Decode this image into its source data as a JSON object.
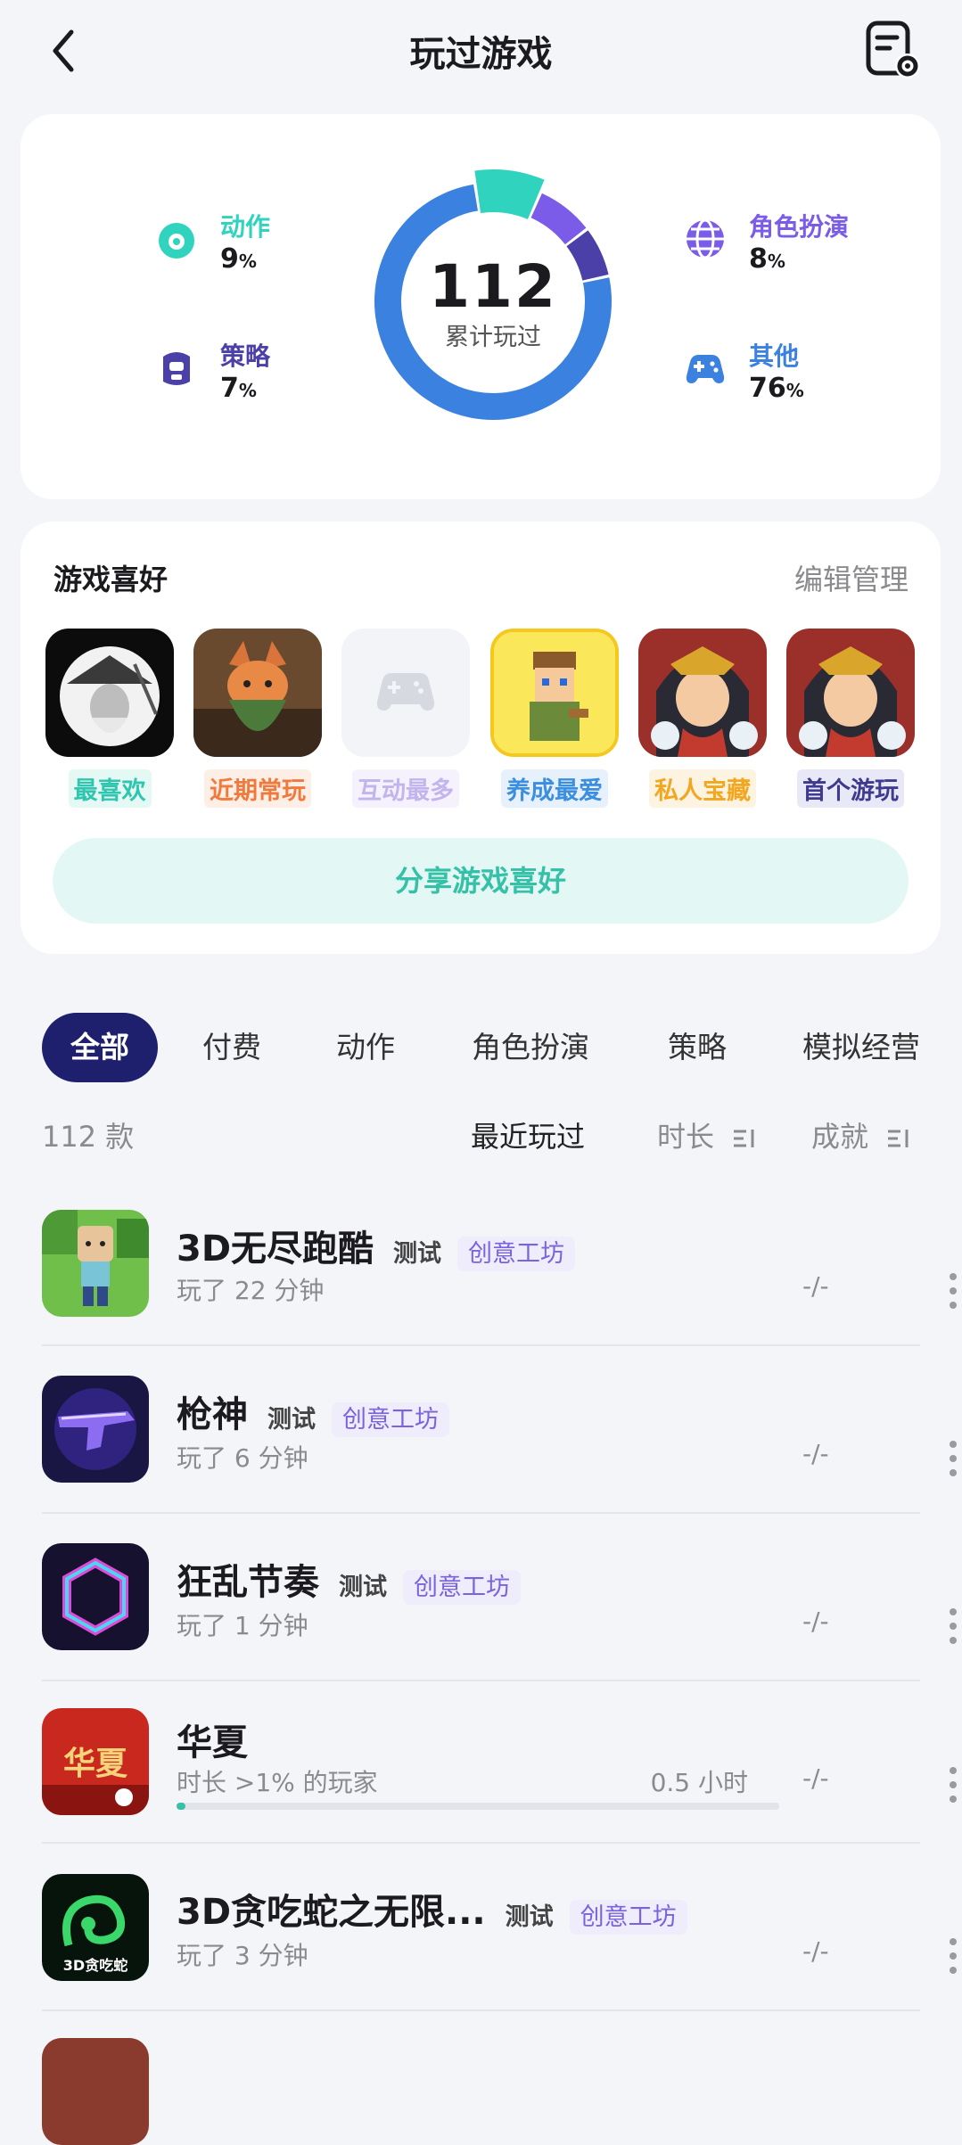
{
  "header": {
    "title": "玩过游戏"
  },
  "stats": {
    "total": "112",
    "total_label": "累计玩过",
    "categories": [
      {
        "name": "动作",
        "pct": "9",
        "color": "#2fd3be",
        "icon": "action-icon"
      },
      {
        "name": "策略",
        "pct": "7",
        "color": "#4b3fa8",
        "icon": "strategy-icon"
      },
      {
        "name": "角色扮演",
        "pct": "8",
        "color": "#7a5ce8",
        "icon": "roleplay-icon"
      },
      {
        "name": "其他",
        "pct": "76",
        "color": "#3b82e0",
        "icon": "gamepad-icon"
      }
    ],
    "pct_sign": "%"
  },
  "preferences": {
    "title": "游戏喜好",
    "edit_label": "编辑管理",
    "items": [
      {
        "label": "最喜欢",
        "color": "#2fc6b0",
        "bg": "#e4f8f4"
      },
      {
        "label": "近期常玩",
        "color": "#f07a3e",
        "bg": "#fdefe6"
      },
      {
        "label": "互动最多",
        "color": "#c2b5ee",
        "bg": "#f5f2fd"
      },
      {
        "label": "养成最爱",
        "color": "#3b8ee0",
        "bg": "#e6f1fc"
      },
      {
        "label": "私人宝藏",
        "color": "#f3a620",
        "bg": "#fdf3e1"
      },
      {
        "label": "首个游玩",
        "color": "#3d3a8f",
        "bg": "#e9e8f6"
      }
    ],
    "share_label": "分享游戏喜好"
  },
  "tabs": [
    "全部",
    "付费",
    "动作",
    "角色扮演",
    "策略",
    "模拟经营"
  ],
  "list": {
    "count": "112 款",
    "sort_recent": "最近玩过",
    "sort_duration": "时长",
    "sort_achievement": "成就"
  },
  "games": [
    {
      "name": "3D无尽跑酷",
      "test": "测试",
      "workshop": "创意工坊",
      "sub": "玩了 22 分钟",
      "ach": "-/-"
    },
    {
      "name": "枪神",
      "test": "测试",
      "workshop": "创意工坊",
      "sub": "玩了 6 分钟",
      "ach": "-/-"
    },
    {
      "name": "狂乱节奏",
      "test": "测试",
      "workshop": "创意工坊",
      "sub": "玩了 1 分钟",
      "ach": "-/-"
    },
    {
      "name": "华夏",
      "sub": "时长 >1% 的玩家",
      "hours": "0.5 小时",
      "progress": 0.01,
      "ach": "-/-"
    },
    {
      "name": "3D贪吃蛇之无限...",
      "test": "测试",
      "workshop": "创意工坊",
      "sub": "玩了 3 分钟",
      "ach": "-/-"
    }
  ],
  "icon_text": {
    "huaxia": "华夏",
    "snake": "3D贪吃蛇"
  }
}
